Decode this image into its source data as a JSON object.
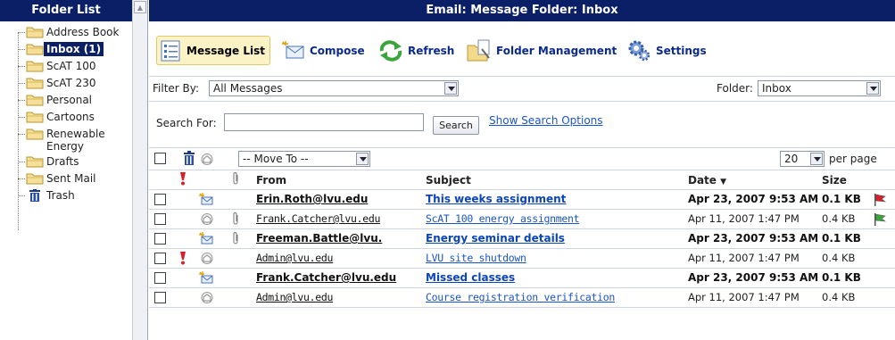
{
  "sidebar": {
    "header": "Folder List",
    "folders": [
      {
        "label": "Address Book",
        "icon": "folder-icon"
      },
      {
        "label": "Inbox (1)",
        "icon": "folder-icon",
        "selected": true
      },
      {
        "label": "ScAT 100",
        "icon": "folder-icon"
      },
      {
        "label": "ScAT 230",
        "icon": "folder-icon"
      },
      {
        "label": "Personal",
        "icon": "folder-icon"
      },
      {
        "label": "Cartoons",
        "icon": "folder-icon"
      },
      {
        "label": "Renewable\nEnergy",
        "icon": "folder-icon"
      },
      {
        "label": "Drafts",
        "icon": "folder-icon"
      },
      {
        "label": "Sent Mail",
        "icon": "folder-icon"
      },
      {
        "label": "Trash",
        "icon": "trash-icon"
      }
    ]
  },
  "main": {
    "title": "Email: Message Folder: Inbox",
    "toolbar": {
      "message_list": "Message List",
      "compose": "Compose",
      "refresh": "Refresh",
      "folder_management": "Folder Management",
      "settings": "Settings"
    },
    "filter": {
      "label": "Filter By:",
      "value": "All Messages",
      "folder_label": "Folder:",
      "folder_value": "Inbox"
    },
    "search": {
      "label": "Search For:",
      "value": "",
      "button": "Search",
      "options_link": "Show Search Options"
    },
    "actions": {
      "move_to": "-- Move To --",
      "per_page_value": "20",
      "per_page_label": "per page"
    },
    "table": {
      "columns": {
        "from": "From",
        "subject": "Subject",
        "date": "Date",
        "sort_indicator": "▼",
        "size": "Size"
      },
      "rows": [
        {
          "from": "Erin.Roth@lvu.edu",
          "subject": "This weeks assignment",
          "date": "Apr 23, 2007 9:53 AM",
          "size": "0.1 KB",
          "unread": true,
          "important": false,
          "attachment": false,
          "flag": "red"
        },
        {
          "from": "Frank.Catcher@lvu.edu",
          "subject": "ScAT 100 energy assignment",
          "date": "Apr 11, 2007 1:47 PM",
          "size": "0.4 KB",
          "unread": false,
          "important": false,
          "attachment": true,
          "flag": "green"
        },
        {
          "from": "Freeman.Battle@lvu.",
          "subject": "Energy seminar details",
          "date": "Apr 23, 2007 9:53 AM",
          "size": "0.1 KB",
          "unread": true,
          "important": false,
          "attachment": true,
          "flag": ""
        },
        {
          "from": "Admin@lvu.edu",
          "subject": "LVU site shutdown",
          "date": "Apr 11, 2007 1:47 PM",
          "size": "0.4 KB",
          "unread": false,
          "important": true,
          "attachment": false,
          "flag": ""
        },
        {
          "from": "Frank.Catcher@lvu.edu",
          "subject": "Missed classes",
          "date": "Apr 23, 2007 9:53 AM",
          "size": "0.1 KB",
          "unread": true,
          "important": false,
          "attachment": false,
          "flag": ""
        },
        {
          "from": "Admin@lvu.edu",
          "subject": "Course registration verification",
          "date": "Apr 11, 2007 1:47 PM",
          "size": "0.4 KB",
          "unread": false,
          "important": false,
          "attachment": false,
          "flag": ""
        }
      ]
    }
  },
  "colors": {
    "header_bg": "#0a1f66",
    "link": "#1a55c4",
    "active_btn_bg": "#fbf3c6",
    "flag_red": "#d8202a",
    "flag_green": "#3aa53a"
  }
}
